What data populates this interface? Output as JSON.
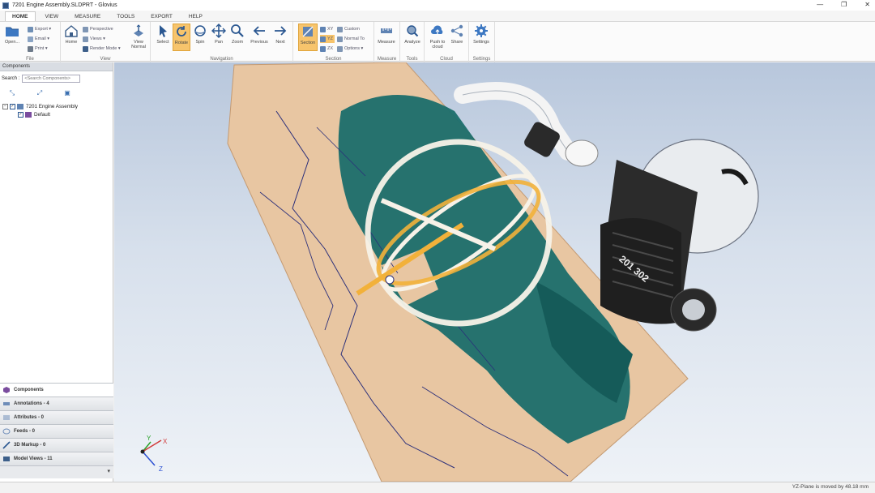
{
  "window": {
    "title": "7201 Engine Assembly.SLDPRT - Glovius"
  },
  "menu_tabs": [
    "HOME",
    "VIEW",
    "MEASURE",
    "TOOLS",
    "EXPORT",
    "HELP"
  ],
  "ribbon": {
    "file": {
      "open": "Open...",
      "export": "Export",
      "email": "Email",
      "print": "Print",
      "label": "File"
    },
    "view": {
      "home": "Home",
      "perspective": "Perspective",
      "views": "Views",
      "render_mode": "Render Mode",
      "view_normal": "View Normal",
      "label": "View"
    },
    "navigation": {
      "select": "Select",
      "rotate": "Rotate",
      "spin": "Spin",
      "pan": "Pan",
      "zoom": "Zoom",
      "previous": "Previous",
      "next": "Next",
      "label": "Navigation"
    },
    "section": {
      "section": "Section",
      "xy": "XY",
      "yz": "YZ",
      "zx": "ZX",
      "custom": "Custom",
      "normal_to": "Normal To",
      "options": "Options",
      "label": "Section"
    },
    "measure": {
      "measure": "Measure",
      "label": "Measure"
    },
    "tools": {
      "analyze": "Analyze",
      "label": "Tools"
    },
    "cloud": {
      "push_to_cloud": "Push to cloud",
      "share": "Share",
      "label": "Cloud"
    },
    "settings": {
      "settings": "Settings",
      "label": "Settings"
    }
  },
  "left_panel": {
    "header": "Components",
    "search_label": "Search :",
    "search_placeholder": "<Search Components>",
    "tree": {
      "root": "7201 Engine Assembly",
      "child": "Default"
    }
  },
  "accordion": [
    {
      "label": "Components",
      "icon": "cube-icon"
    },
    {
      "label": "Annotations - 4",
      "icon": "annotation-icon"
    },
    {
      "label": "Attributes - 0",
      "icon": "attributes-icon"
    },
    {
      "label": "Feeds - 0",
      "icon": "feeds-icon"
    },
    {
      "label": "3D Markup - 0",
      "icon": "markup-icon"
    },
    {
      "label": "Model Views - 11",
      "icon": "model-views-icon"
    }
  ],
  "viewport": {
    "engine_label": "201 302",
    "axis_y": "Y",
    "axis_x": "X",
    "axis_z": "Z"
  },
  "status": {
    "message": "YZ-Plane is moved by 48.18 mm"
  },
  "colors": {
    "accent": "#f7c46c",
    "section_teal": "#1b6e6b",
    "plane": "#e9c9a6"
  }
}
